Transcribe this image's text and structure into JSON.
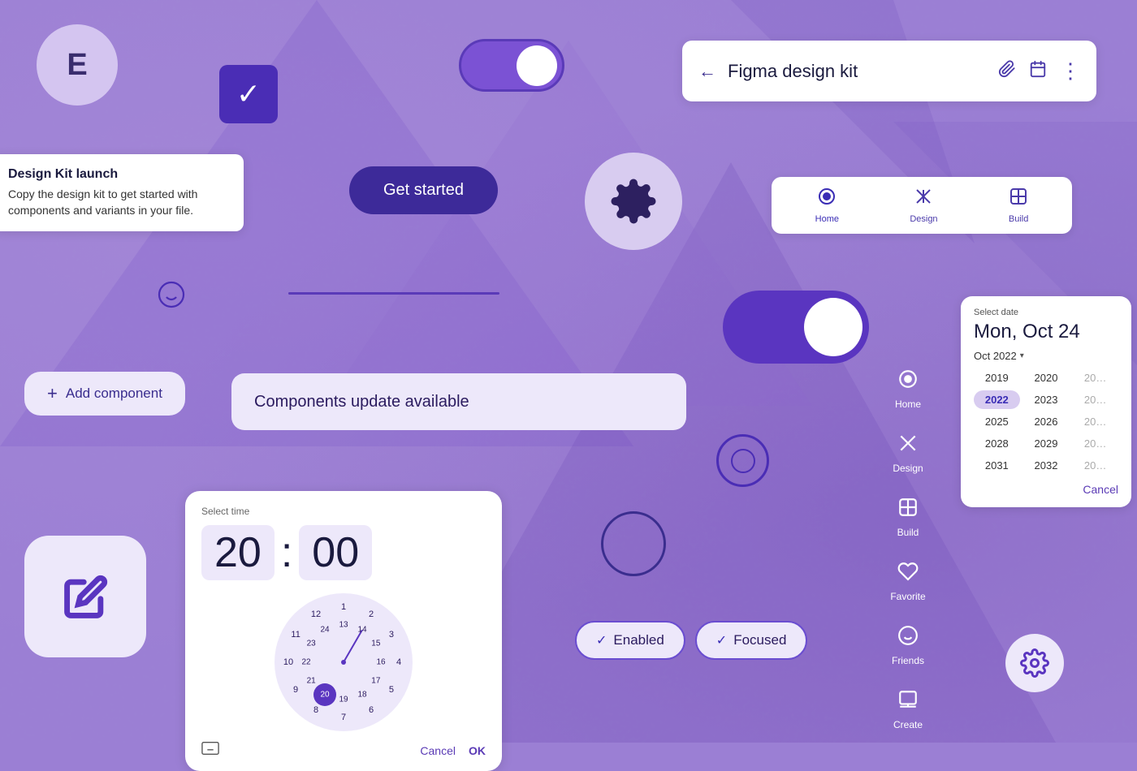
{
  "background": {
    "color": "#9b7fd4"
  },
  "avatar": {
    "label": "E"
  },
  "snackbar": {
    "title": "Design Kit launch",
    "body": "Copy the design kit to get started with components and variants in your file."
  },
  "get_started_button": {
    "label": "Get started"
  },
  "app_bar": {
    "title": "Figma design kit",
    "back_icon": "←",
    "attach_icon": "📎",
    "calendar_icon": "📅",
    "more_icon": "⋮"
  },
  "bottom_nav": {
    "items": [
      {
        "icon": "⊙",
        "label": "Home",
        "active": true
      },
      {
        "icon": "✂",
        "label": "Design",
        "active": false
      },
      {
        "icon": "⊡",
        "label": "Build",
        "active": false
      }
    ]
  },
  "toggle_top": {
    "state": "on"
  },
  "toggle_large": {
    "state": "on"
  },
  "alert_banner": {
    "text": "Components update available"
  },
  "fab_button": {
    "label": "Add component",
    "plus": "+"
  },
  "date_picker": {
    "header_label": "Select date",
    "date": "Mon, Oct 24",
    "month": "Oct 2022",
    "years": [
      [
        "2019",
        "2020",
        "20"
      ],
      [
        "2022",
        "2023",
        "20"
      ],
      [
        "2025",
        "2026",
        "20"
      ],
      [
        "2028",
        "2029",
        "20"
      ],
      [
        "2031",
        "2032",
        "20"
      ]
    ],
    "cancel_label": "Cancel"
  },
  "nav_rail": {
    "items": [
      {
        "icon": "⊙",
        "label": "Home"
      },
      {
        "icon": "✂",
        "label": "Design"
      },
      {
        "icon": "⊡",
        "label": "Build"
      },
      {
        "icon": "♡",
        "label": "Favorite"
      },
      {
        "icon": "☺",
        "label": "Friends"
      },
      {
        "icon": "⊟",
        "label": "Create"
      }
    ]
  },
  "time_picker": {
    "header_label": "Select time",
    "hours": "20",
    "colon": ":",
    "minutes": "00",
    "cancel_label": "Cancel",
    "ok_label": "OK",
    "clock_numbers": [
      {
        "n": "11",
        "angle": 300,
        "r": 70
      },
      {
        "n": "12",
        "angle": 330,
        "r": 70
      },
      {
        "n": "1",
        "angle": 0,
        "r": 70
      },
      {
        "n": "23",
        "angle": 300,
        "r": 48
      },
      {
        "n": "24",
        "angle": 330,
        "r": 48
      },
      {
        "n": "13",
        "angle": 0,
        "r": 48
      },
      {
        "n": "10",
        "angle": 270,
        "r": 70
      },
      {
        "n": "22",
        "angle": 270,
        "r": 48
      },
      {
        "n": "14",
        "angle": 30,
        "r": 48
      },
      {
        "n": "2",
        "angle": 30,
        "r": 70
      },
      {
        "n": "9",
        "angle": 240,
        "r": 70
      },
      {
        "n": "21",
        "angle": 240,
        "r": 48
      },
      {
        "n": "15",
        "angle": 60,
        "r": 48
      },
      {
        "n": "3",
        "angle": 60,
        "r": 70
      },
      {
        "n": "8",
        "angle": 210,
        "r": 70
      },
      {
        "n": "20",
        "angle": 210,
        "r": 48
      },
      {
        "n": "16",
        "angle": 90,
        "r": 48
      },
      {
        "n": "4",
        "angle": 90,
        "r": 70
      },
      {
        "n": "7",
        "angle": 180,
        "r": 70
      },
      {
        "n": "19",
        "angle": 180,
        "r": 48
      },
      {
        "n": "17",
        "angle": 120,
        "r": 48
      },
      {
        "n": "5",
        "angle": 120,
        "r": 70
      },
      {
        "n": "18",
        "angle": 150,
        "r": 48
      },
      {
        "n": "6",
        "angle": 150,
        "r": 70
      }
    ]
  },
  "chips": {
    "enabled": {
      "label": "Enabled",
      "check": "✓"
    },
    "focused": {
      "label": "Focused",
      "check": "✓"
    }
  },
  "edit_fab": {
    "aria": "Edit button"
  },
  "settings_gear_br": {
    "aria": "Settings gear icon"
  }
}
